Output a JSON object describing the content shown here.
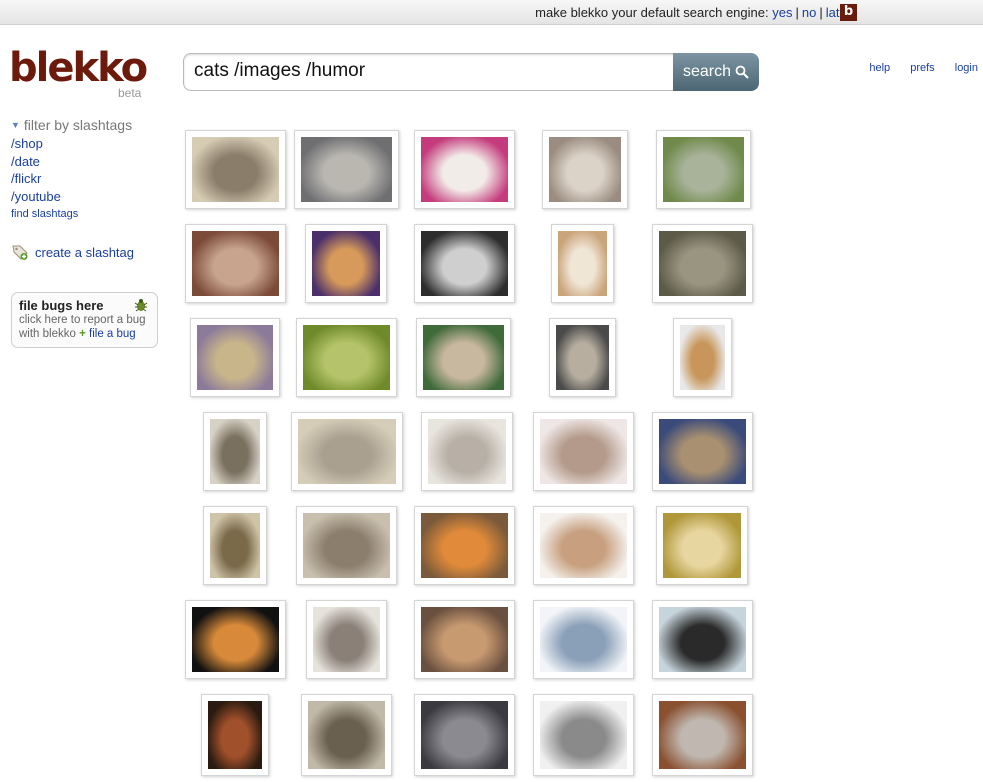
{
  "topbar": {
    "message": "make blekko your default search engine:",
    "yes": "yes",
    "no": "no",
    "later": "later",
    "separator": "|",
    "badge": "b"
  },
  "logo": {
    "text": "blekko",
    "beta": "beta"
  },
  "search": {
    "value": "cats /images /humor",
    "button": "search"
  },
  "toplinks": {
    "help": "help",
    "prefs": "prefs",
    "login": "login"
  },
  "sidebar": {
    "filter_label": "filter by slashtags",
    "slashtags": [
      "/shop",
      "/date",
      "/flickr",
      "/youtube"
    ],
    "find_label": "find slashtags",
    "create_label": "create a slashtag"
  },
  "bugs": {
    "title": "file bugs here",
    "line1": "click here to report a bug",
    "line2": "with blekko",
    "link": "file a bug"
  },
  "colors": {
    "brand": "#6b1a0c",
    "link": "#1a3fa0",
    "search_button": "#5a7382"
  },
  "image_results": [
    {
      "kind": "kitten sleeping",
      "c1": "#d6cbb3",
      "c2": "#8a7d6a"
    },
    {
      "kind": "grey kittens",
      "c1": "#6f6f72",
      "c2": "#b9b7b0"
    },
    {
      "kind": "white persian kittens",
      "c1": "#c43c7d",
      "c2": "#f2ece8"
    },
    {
      "kind": "kittens nursing",
      "c1": "#9a8c80",
      "c2": "#dcd3c8"
    },
    {
      "kind": "cat with plants",
      "c1": "#6f8a4a",
      "c2": "#a8b39a"
    },
    {
      "kind": "kittens sleeping pile",
      "c1": "#7b4a38",
      "c2": "#c8a48f"
    },
    {
      "kind": "kitten surprised",
      "c1": "#4a2f6a",
      "c2": "#d79a5a"
    },
    {
      "kind": "kitten on black",
      "c1": "#2d2d2d",
      "c2": "#cfcfcf"
    },
    {
      "kind": "cat standing",
      "c1": "#caa47a",
      "c2": "#f0e6d6"
    },
    {
      "kind": "cat with grass",
      "c1": "#5c5a48",
      "c2": "#9a9580"
    },
    {
      "kind": "lolcat guards",
      "c1": "#8b7a9a",
      "c2": "#c9b58a"
    },
    {
      "kind": "pugs in grass",
      "c1": "#6f8a2a",
      "c2": "#b5c46a"
    },
    {
      "kind": "cats sunbathing",
      "c1": "#3f6a3a",
      "c2": "#c9b8a0"
    },
    {
      "kind": "cats on clock",
      "c1": "#4a4a4a",
      "c2": "#b7aea0"
    },
    {
      "kind": "muffincat",
      "c1": "#e8e8e8",
      "c2": "#c8965a"
    },
    {
      "kind": "cat poster",
      "c1": "#d8d2c6",
      "c2": "#7a7060"
    },
    {
      "kind": "cat laser",
      "c1": "#d6cdb8",
      "c2": "#a9a090"
    },
    {
      "kind": "white cat",
      "c1": "#e8e4de",
      "c2": "#b8b0a6"
    },
    {
      "kind": "kitten belly",
      "c1": "#efe7e6",
      "c2": "#b39a8a"
    },
    {
      "kind": "woman with cat",
      "c1": "#3a4a7a",
      "c2": "#a89070"
    },
    {
      "kind": "lolcat face",
      "c1": "#d0c4a8",
      "c2": "#7a6a4a"
    },
    {
      "kind": "kitten jumping",
      "c1": "#c8bfae",
      "c2": "#8c7e6c"
    },
    {
      "kind": "orange cat box",
      "c1": "#7a5a3a",
      "c2": "#e08a3a"
    },
    {
      "kind": "two kittens",
      "c1": "#f5f2ee",
      "c2": "#c8a080"
    },
    {
      "kind": "kittens boxing",
      "c1": "#b0983a",
      "c2": "#e8d6a0"
    },
    {
      "kind": "orange cat on black",
      "c1": "#111111",
      "c2": "#d88a3a"
    },
    {
      "kind": "cat yawning",
      "c1": "#e6e2dc",
      "c2": "#8a8078"
    },
    {
      "kind": "cats cuddling",
      "c1": "#6a5040",
      "c2": "#c89a70"
    },
    {
      "kind": "cat on treadmill",
      "c1": "#f2f4f8",
      "c2": "#8aa0b8"
    },
    {
      "kind": "cats shadow",
      "c1": "#c6d4dc",
      "c2": "#2a2a2a"
    },
    {
      "kind": "cats poster dark",
      "c1": "#2a1a10",
      "c2": "#a0502a"
    },
    {
      "kind": "trashcat",
      "c1": "#c0b8a8",
      "c2": "#6a6050"
    },
    {
      "kind": "kittens in basket",
      "c1": "#3a3a40",
      "c2": "#8a8a90"
    },
    {
      "kind": "cartoon",
      "c1": "#f0f0f0",
      "c2": "#8a8a8a"
    },
    {
      "kind": "row of kittens",
      "c1": "#8a5030",
      "c2": "#c0b8b0"
    }
  ]
}
